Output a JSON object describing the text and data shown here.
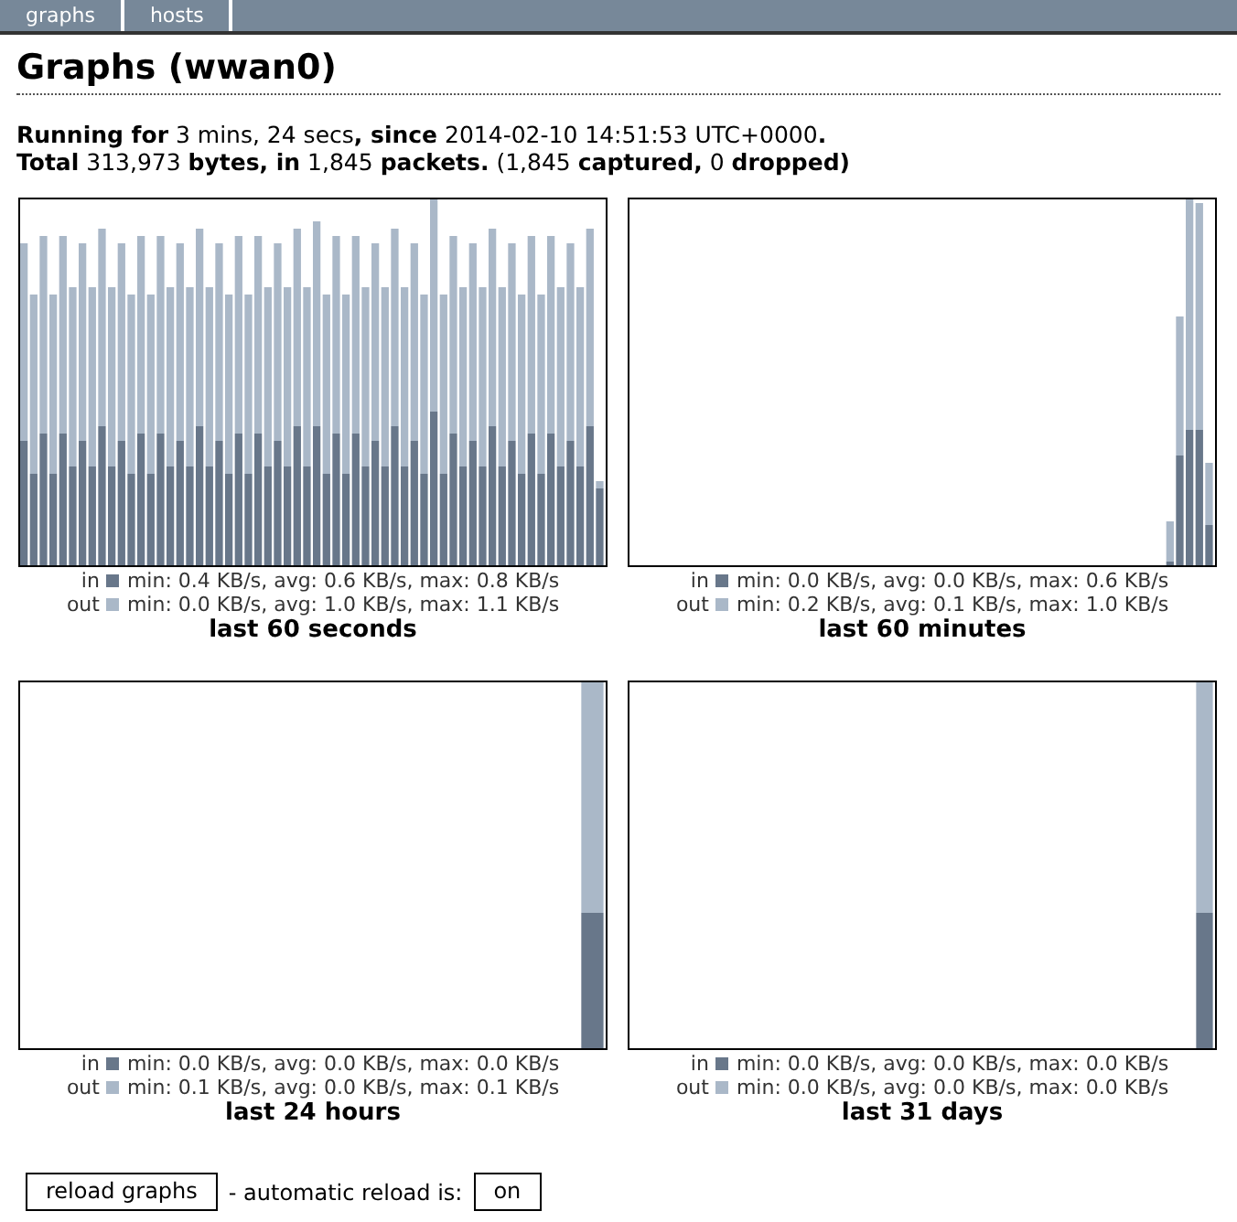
{
  "tabs": [
    {
      "label": "graphs",
      "selected": false
    },
    {
      "label": "hosts",
      "selected": false
    }
  ],
  "title": "Graphs (wwan0)",
  "summary": [
    "**Running for** 3 mins, 24 secs**, since** 2014-02-10 14:51:53 UTC+0000**.**",
    "**Total** 313,973 **bytes, in** 1,845 **packets.** (1,845 **captured,** 0 **dropped)**"
  ],
  "graphs": [
    {
      "kind": "seconds",
      "in_label": "in",
      "in_stats": "min: 0.4 KB/s, avg: 0.6 KB/s, max: 0.8 KB/s",
      "out_label": "out",
      "out_stats": "min: 0.0 KB/s, avg: 1.0 KB/s, max: 1.1 KB/s",
      "caption": "last 60 seconds"
    },
    {
      "kind": "minutes",
      "in_label": "in",
      "in_stats": "min: 0.0 KB/s, avg: 0.0 KB/s, max: 0.6 KB/s",
      "out_label": "out",
      "out_stats": "min: 0.2 KB/s, avg: 0.1 KB/s, max: 1.0 KB/s",
      "caption": "last 60 minutes"
    },
    {
      "kind": "hours",
      "in_label": "in",
      "in_stats": "min: 0.0 KB/s, avg: 0.0 KB/s, max: 0.0 KB/s",
      "out_label": "out",
      "out_stats": "min: 0.1 KB/s, avg: 0.0 KB/s, max: 0.1 KB/s",
      "caption": "last 24 hours"
    },
    {
      "kind": "days",
      "in_label": "in",
      "in_stats": "min: 0.0 KB/s, avg: 0.0 KB/s, max: 0.0 KB/s",
      "out_label": "out",
      "out_stats": "min: 0.0 KB/s, avg: 0.0 KB/s, max: 0.0 KB/s",
      "caption": "last 31 days"
    }
  ],
  "footer": {
    "reload_button": "reload graphs",
    "auto_text": "- automatic reload is:",
    "toggle": "on"
  }
}
